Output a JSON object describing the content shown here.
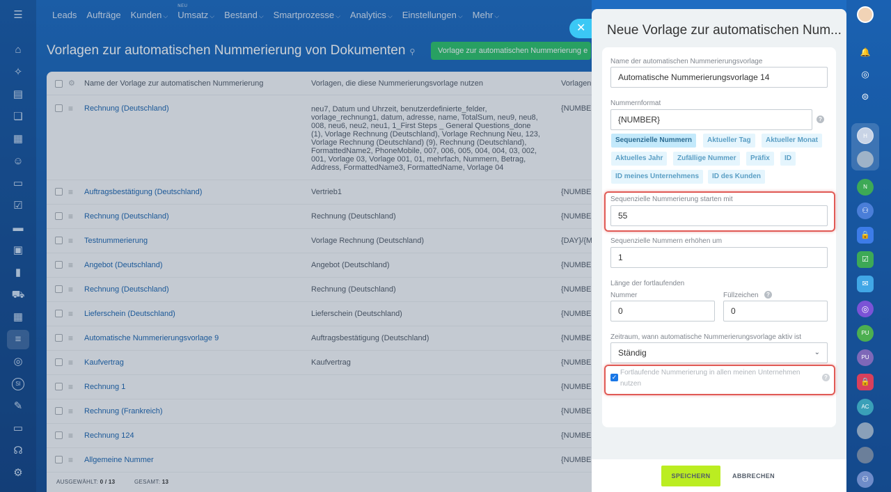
{
  "topnav": {
    "items": [
      {
        "label": "Leads",
        "caret": ""
      },
      {
        "label": "Aufträge",
        "caret": ""
      },
      {
        "label": "Kunden",
        "caret": "⌵"
      },
      {
        "label": "Umsatz",
        "caret": "⌵",
        "badge": "NEU"
      },
      {
        "label": "Bestand",
        "caret": "⌵"
      },
      {
        "label": "Smartprozesse",
        "caret": "⌵"
      },
      {
        "label": "Analytics",
        "caret": "⌵"
      },
      {
        "label": "Einstellungen",
        "caret": "⌵"
      },
      {
        "label": "Mehr",
        "caret": "⌵"
      }
    ]
  },
  "page": {
    "title": "Vorlagen zur automatischen Nummerierung von Dokumenten",
    "add_button": "Vorlage zur automatischen Nummerierung e"
  },
  "table": {
    "headers": {
      "name": "Name der Vorlage zur automatischen Nummerierung",
      "templates": "Vorlagen, die diese Nummerierungsvorlage nutzen",
      "format": "Vorlagen"
    },
    "rows": [
      {
        "name": "Rechnung (Deutschland)",
        "templates": "neu7, Datum und Uhrzeit, benutzerdefinierte_felder, vorlage_rechnung1, datum, adresse, name, TotalSum, neu9, neu8, 008, neu6, neu2, neu1, 1_First Steps _ General Questions_done (1), Vorlage Rechnung (Deutschland), Vorlage Rechnung Neu, 123, Vorlage Rechnung (Deutschland) (9), Rechnung (Deutschland), FormattedName2, PhoneMobile, 007, 006, 005, 004, 004, 03, 002, 001, Vorlage 03, Vorlage 001, 01, mehrfach, Nummern, Betrag, Address, FormattedName3, FormattedName, Vorlage 04",
        "format": "{NUMBER"
      },
      {
        "name": "Auftragsbestätigung (Deutschland)",
        "templates": "Vertrieb1",
        "format": "{NUMBER"
      },
      {
        "name": "Rechnung (Deutschland)",
        "templates": "Rechnung (Deutschland)",
        "format": "{NUMBER"
      },
      {
        "name": "Testnummerierung",
        "templates": "Vorlage Rechnung (Deutschland)",
        "format": "{DAY}/{M"
      },
      {
        "name": "Angebot (Deutschland)",
        "templates": "Angebot (Deutschland)",
        "format": "{NUMBER"
      },
      {
        "name": "Rechnung (Deutschland)",
        "templates": "Rechnung (Deutschland)",
        "format": "{NUMBER"
      },
      {
        "name": "Lieferschein (Deutschland)",
        "templates": "Lieferschein (Deutschland)",
        "format": "{NUMBER"
      },
      {
        "name": "Automatische Nummerierungsvorlage 9",
        "templates": "Auftragsbestätigung (Deutschland)",
        "format": "{NUMBER"
      },
      {
        "name": "Kaufvertrag",
        "templates": "Kaufvertrag",
        "format": "{NUMBER"
      },
      {
        "name": "Rechnung 1",
        "templates": "",
        "format": "{NUMBER"
      },
      {
        "name": "Rechnung (Frankreich)",
        "templates": "",
        "format": "{NUMBER"
      },
      {
        "name": "Rechnung 124",
        "templates": "",
        "format": "{NUMBER"
      },
      {
        "name": "Allgemeine Nummer",
        "templates": "",
        "format": "{NUMBER"
      }
    ],
    "footer": {
      "selected_label": "AUSGEWÄHLT:",
      "selected_value": "0 / 13",
      "total_label": "GESAMT:",
      "total_value": "13"
    }
  },
  "panel": {
    "title": "Neue Vorlage zur automatischen Num...",
    "name_label": "Name der automatischen Nummerierungsvorlage",
    "name_value": "Automatische Nummerierungsvorlage  14",
    "format_label": "Nummernformat",
    "format_value": "{NUMBER}",
    "chips": [
      "Sequenzielle Nummern",
      "Aktueller Tag",
      "Aktueller Monat",
      "Aktuelles Jahr",
      "Zufällige Nummer",
      "Präfix",
      "ID",
      "ID meines Unternehmens",
      "ID des Kunden"
    ],
    "start_label": "Sequenzielle Nummerierung starten mit",
    "start_value": "55",
    "step_label": "Sequenzielle Nummern erhöhen um",
    "step_value": "1",
    "length_label": "Länge der fortlaufenden",
    "number_label": "Nummer",
    "number_value": "0",
    "fill_label": "Füllzeichen",
    "fill_value": "0",
    "period_label": "Zeitraum, wann automatische Nummerierungsvorlage aktiv ist",
    "period_value": "Ständig",
    "checkbox_label": "Fortlaufende Nummerierung in allen meinen Unternehmen nutzen",
    "save": "SPEICHERN",
    "cancel": "ABBRECHEN"
  },
  "leftbar": {
    "initials": "SI"
  },
  "rightbar": {
    "badges": [
      "H",
      "N",
      "PU",
      "PU",
      "AC"
    ]
  },
  "colors": {
    "accent_blue": "#2067b0",
    "save_green": "#bbed21",
    "add_green": "#2fc26b",
    "highlight_red": "#e05a55"
  }
}
